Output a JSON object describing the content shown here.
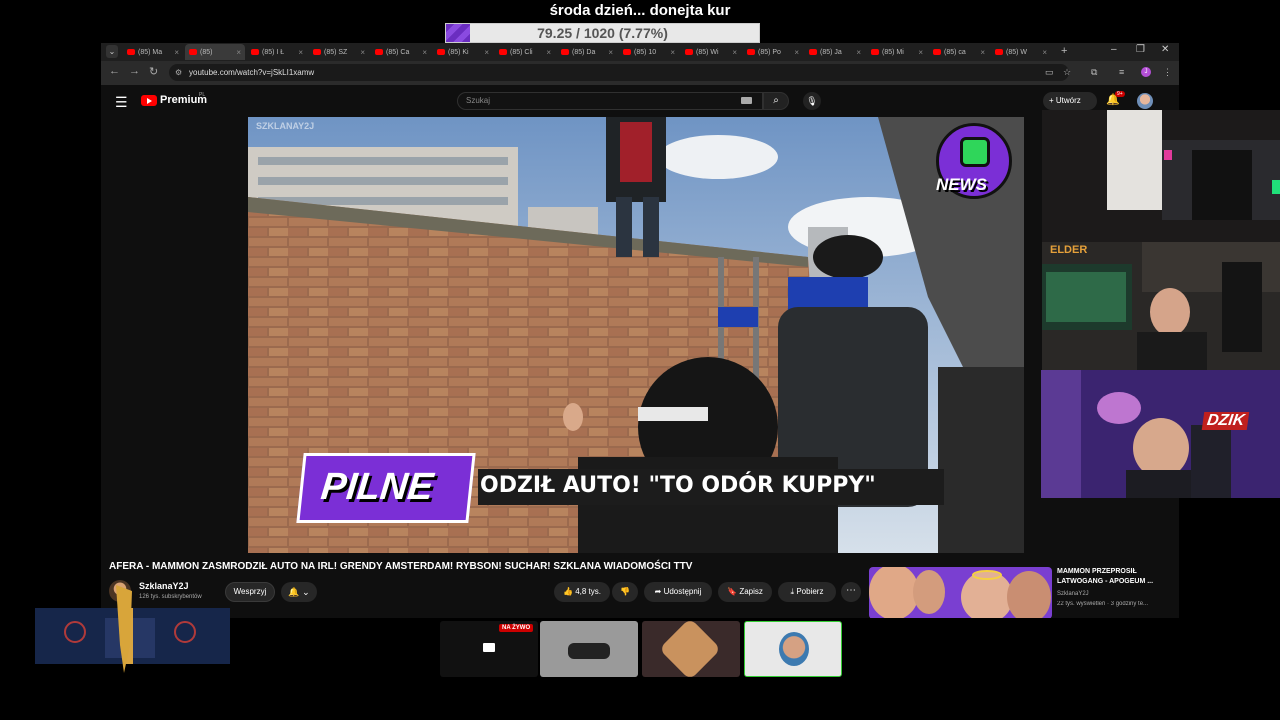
{
  "overlay": {
    "title": "środa dzień... donejta kur",
    "goal_text": "79.25 / 1020 (7.77%)",
    "goal_fraction": 0.0777
  },
  "browser": {
    "tabs": [
      {
        "label": "(85) Ma"
      },
      {
        "label": "(85)"
      },
      {
        "label": "(85) I Ł"
      },
      {
        "label": "(85) SZ"
      },
      {
        "label": "(85) Ca"
      },
      {
        "label": "(85) Ki"
      },
      {
        "label": "(85) Cli"
      },
      {
        "label": "(85) Da"
      },
      {
        "label": "(85) 10"
      },
      {
        "label": "(85) Wi"
      },
      {
        "label": "(85) Po"
      },
      {
        "label": "(85) Ja"
      },
      {
        "label": "(85) Mi"
      },
      {
        "label": "(85) ca"
      },
      {
        "label": "(85) W"
      }
    ],
    "new_tab": "+",
    "url": "youtube.com/watch?v=jSkLI1xamw"
  },
  "youtube": {
    "brand": "Premium",
    "region": "PL",
    "search_placeholder": "Szukaj",
    "create_label": "Utwórz",
    "notification_count": "9+",
    "video_title": "AFERA - MAMMON ZASMRODZIŁ AUTO NA IRL! GRENDY AMSTERDAM! RYBSON! SUCHAR! SZKLANA WIADOMOŚCI TTV",
    "channel_name": "SzklanaY2J",
    "channel_subs": "126 tys. subskrybentów",
    "support_label": "Wesprzyj",
    "like_count": "4,8 tys.",
    "share_label": "Udostępnij",
    "save_label": "Zapisz",
    "download_label": "Pobierz",
    "video_overlay": {
      "watermark": "SZKLANAY2J",
      "badge": "PILNE",
      "ticker": "ODZIŁ AUTO! \"TO ODÓR KUPPY\"",
      "logo": "NEWS"
    },
    "recommended": {
      "title": "MAMMON PRZEPROSIŁ LATWOGANG - APOGEUM ...",
      "channel": "SzklanaY2J",
      "meta": "22 tys. wyświetleń · 3 godziny te..."
    }
  },
  "webcams": {
    "mid_sign": "ELDER",
    "bot_logo": "DZIK"
  },
  "scenes": {
    "live_label": "NA ŻYWO"
  },
  "colors": {
    "accent_purple": "#7b2fd6",
    "youtube_red": "#ff0000",
    "live_red": "#cc0000"
  }
}
